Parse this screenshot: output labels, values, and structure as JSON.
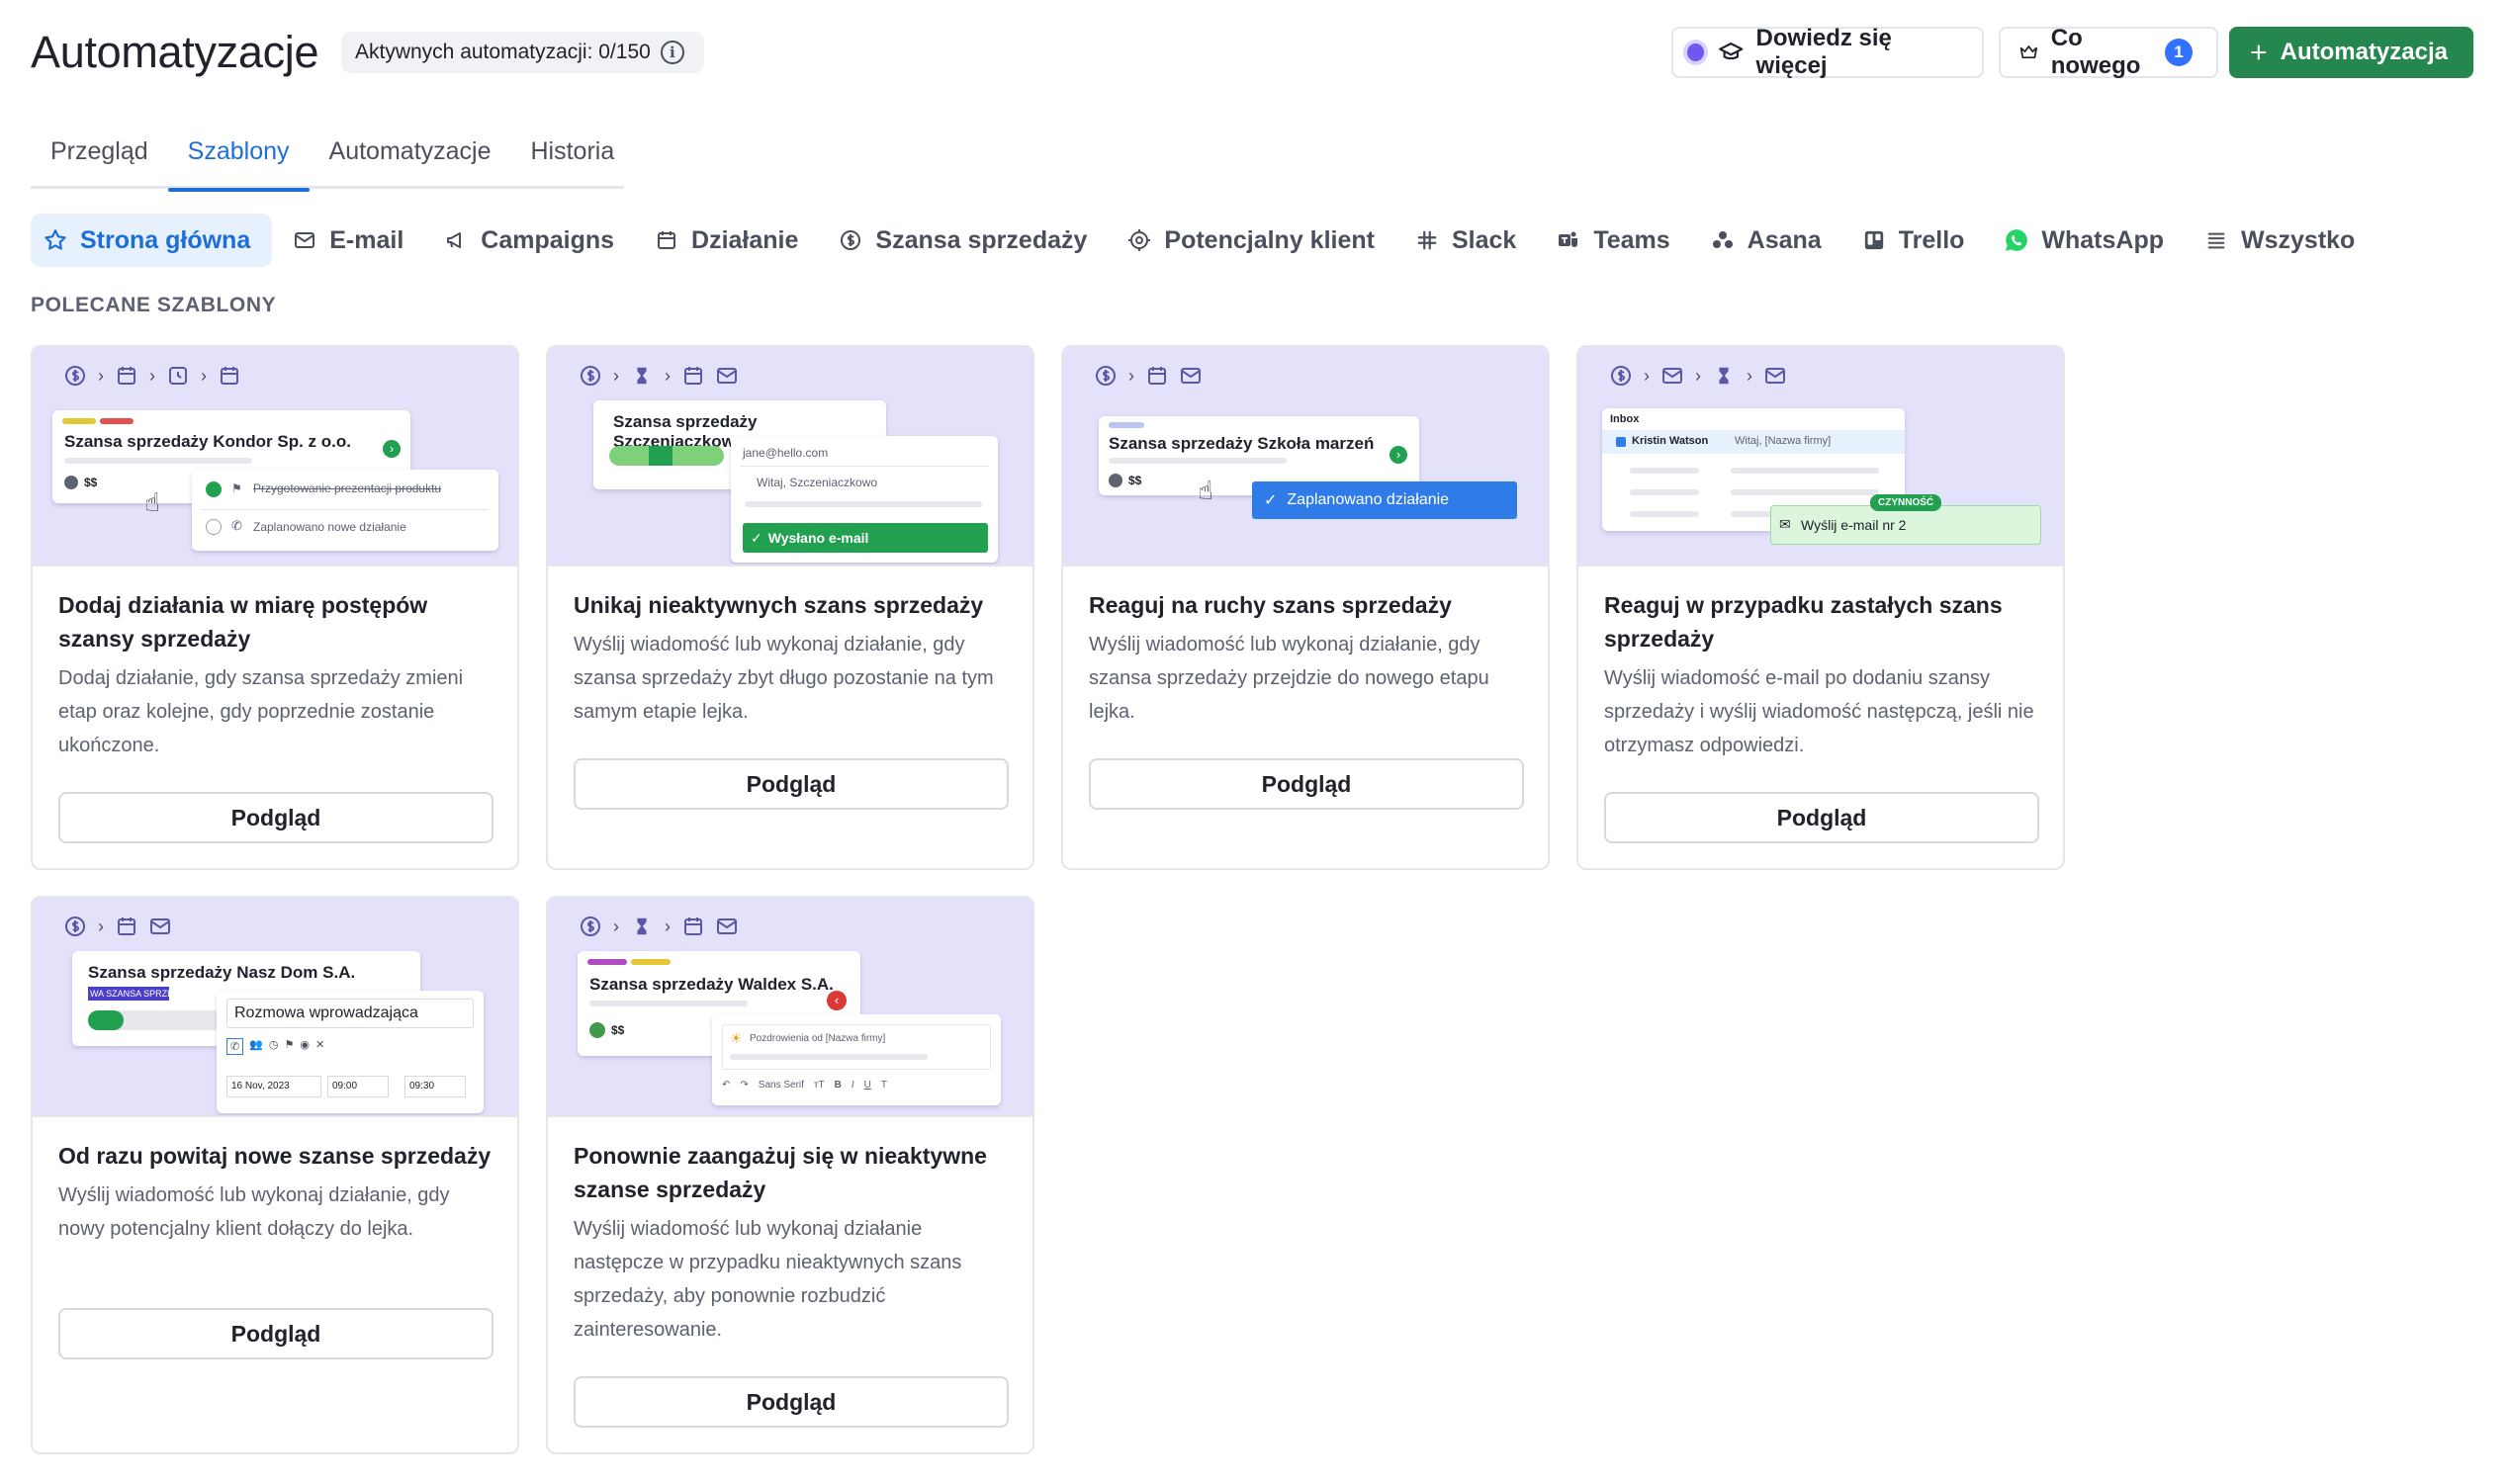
{
  "header": {
    "title": "Automatyzacje",
    "active_count": "Aktywnych automatyzacji: 0/150",
    "learn_more": "Dowiedz się więcej",
    "whats_new": "Co nowego",
    "whats_new_count": "1",
    "add_automation": "Automatyzacja"
  },
  "tabs": [
    {
      "label": "Przegląd"
    },
    {
      "label": "Szablony"
    },
    {
      "label": "Automatyzacje"
    },
    {
      "label": "Historia"
    }
  ],
  "categories": [
    {
      "label": "Strona główna"
    },
    {
      "label": "E-mail"
    },
    {
      "label": "Campaigns"
    },
    {
      "label": "Działanie"
    },
    {
      "label": "Szansa sprzedaży"
    },
    {
      "label": "Potencjalny klient"
    },
    {
      "label": "Slack"
    },
    {
      "label": "Teams"
    },
    {
      "label": "Asana"
    },
    {
      "label": "Trello"
    },
    {
      "label": "WhatsApp"
    },
    {
      "label": "Wszystko"
    }
  ],
  "section_label": "POLECANE SZABLONY",
  "preview_label": "Podgląd",
  "cards": [
    {
      "title": "Dodaj działania w miarę postępów szansy sprzedaży",
      "desc": "Dodaj działanie, gdy szansa sprzedaży zmieni etap oraz kolejne, gdy poprzednie zostanie ukończone.",
      "mock_title": "Szansa sprzedaży Kondor Sp. z o.o.",
      "mock_value": "$$",
      "mock_item1": "Przygotowanie prezentacji produktu",
      "mock_item2": "Zaplanowano nowe działanie"
    },
    {
      "title": "Unikaj nieaktywnych szans sprzedaży",
      "desc": "Wyślij wiadomość lub wykonaj działanie, gdy szansa sprzedaży zbyt długo pozostanie na tym samym etapie lejka.",
      "mock_title": "Szansa sprzedaży Szczeniaczkowo",
      "mock_email": "jane@hello.com",
      "mock_greet": "Witaj, Szczeniaczkowo",
      "mock_sent": "Wysłano e-mail"
    },
    {
      "title": "Reaguj na ruchy szans sprzedaży",
      "desc": "Wyślij wiadomość lub wykonaj działanie, gdy szansa sprzedaży przejdzie do nowego etapu lejka.",
      "mock_title": "Szansa sprzedaży Szkoła marzeń",
      "mock_value": "$$",
      "mock_scheduled": "Zaplanowano działanie"
    },
    {
      "title": "Reaguj w przypadku zastałych szans sprzedaży",
      "desc": "Wyślij wiadomość e-mail po dodaniu szansy sprzedaży i wyślij wiadomość następczą, jeśli nie otrzymasz odpowiedzi.",
      "mock_inbox": "Inbox",
      "mock_contact": "Kristin Watson",
      "mock_greet": "Witaj, [Nazwa firmy]",
      "mock_badge": "CZYNNOŚĆ",
      "mock_send": "Wyślij e-mail nr 2"
    },
    {
      "title": "Od razu powitaj nowe szanse sprzedaży",
      "desc": "Wyślij wiadomość lub wykonaj działanie, gdy nowy potencjalny klient dołączy do lejka.",
      "mock_title": "Szansa sprzedaży Nasz Dom S.A.",
      "mock_tag": "WA SZANSA SPRZEDA",
      "mock_call": "Rozmowa wprowadzająca",
      "mock_date": "16 Nov, 2023",
      "mock_from": "09:00",
      "mock_to": "09:30"
    },
    {
      "title": "Ponownie zaangażuj się w nieaktywne szanse sprzedaży",
      "desc": "Wyślij wiadomość lub wykonaj działanie następcze w przypadku nieaktywnych szans sprzedaży, aby ponownie rozbudzić zainteresowanie.",
      "mock_title": "Szansa sprzedaży Waldex S.A.",
      "mock_value": "$$",
      "mock_greet": "Pozdrowienia od [Nazwa firmy]",
      "mock_font": "Sans Serif"
    }
  ],
  "colors": {
    "accent": "#1d6fd8",
    "primary_button": "#25864e",
    "badge": "#3173ff",
    "preview_bg": "#e4e1fb"
  }
}
